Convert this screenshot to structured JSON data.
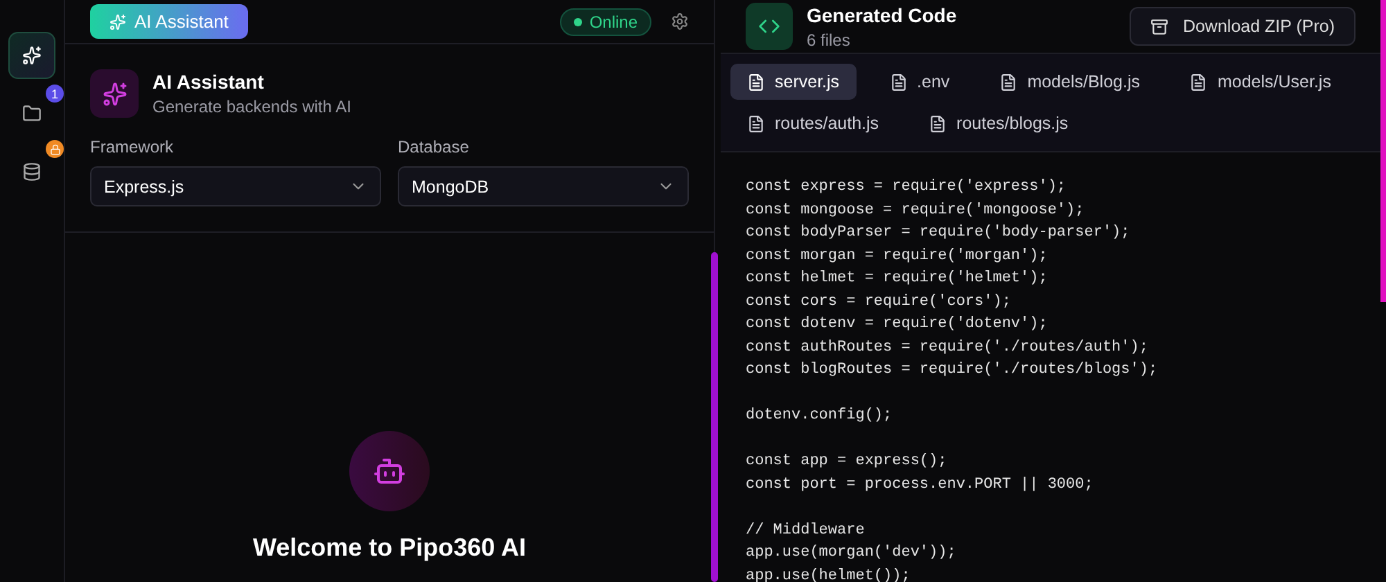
{
  "sidebar": {
    "items": [
      {
        "kind": "sparkles",
        "selected": true
      },
      {
        "kind": "folder",
        "selected": false,
        "badge": "1"
      },
      {
        "kind": "database",
        "selected": false,
        "locked": true
      }
    ]
  },
  "topbar": {
    "button": "AI Assistant",
    "status": "Online"
  },
  "assistant": {
    "title": "AI Assistant",
    "subtitle": "Generate backends with AI",
    "fields": [
      {
        "label": "Framework",
        "value": "Express.js"
      },
      {
        "label": "Database",
        "value": "MongoDB"
      }
    ],
    "welcome": "Welcome to Pipo360 AI"
  },
  "code_panel": {
    "title": "Generated Code",
    "subtitle": "6 files",
    "download": "Download ZIP (Pro)",
    "tabs": [
      {
        "label": "server.js",
        "selected": true
      },
      {
        "label": ".env",
        "selected": false
      },
      {
        "label": "models/Blog.js",
        "selected": false
      },
      {
        "label": "models/User.js",
        "selected": false
      },
      {
        "label": "routes/auth.js",
        "selected": false
      },
      {
        "label": "routes/blogs.js",
        "selected": false
      }
    ],
    "code": [
      [
        "const express = require('express');",
        "const mongoose = require('mongoose');",
        "const bodyParser = require('body-parser');",
        "const morgan = require('morgan');",
        "const helmet = require('helmet');",
        "const cors = require('cors');",
        "const dotenv = require('dotenv');",
        "const authRoutes = require('./routes/auth');",
        "const blogRoutes = require('./routes/blogs');"
      ],
      [
        "dotenv.config();"
      ],
      [
        "const app = express();",
        "const port = process.env.PORT || 3000;"
      ],
      [
        "// Middleware",
        "app.use(morgan('dev'));",
        "app.use(helmet());"
      ]
    ]
  }
}
